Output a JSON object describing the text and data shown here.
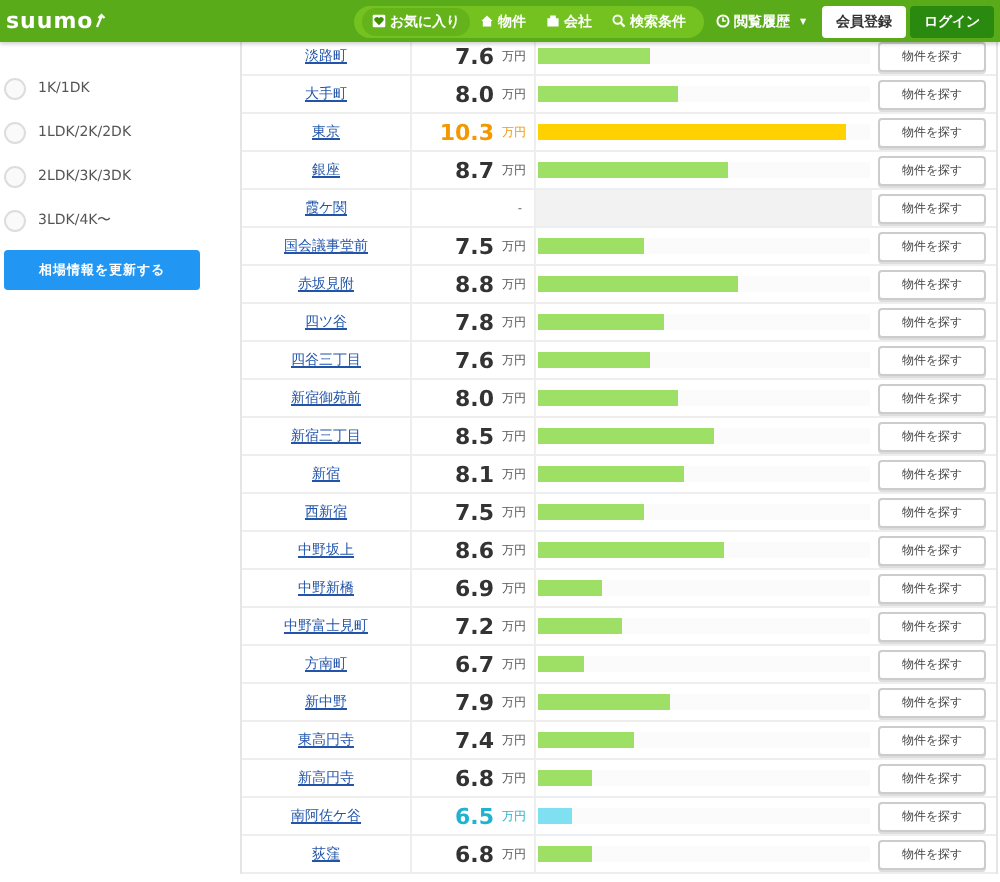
{
  "header": {
    "logo": "suumo",
    "nav": [
      {
        "label": "お気に入り",
        "selected": true
      },
      {
        "label": "物件",
        "selected": false
      },
      {
        "label": "会社",
        "selected": false
      },
      {
        "label": "検索条件",
        "selected": false
      }
    ],
    "history": {
      "label": "閲覧履歴",
      "caret": "▼"
    },
    "register": "会員登録",
    "login": "ログイン"
  },
  "sidebar": {
    "options": [
      {
        "label": "1K/1DK",
        "selected": false
      },
      {
        "label": "1LDK/2K/2DK",
        "selected": false
      },
      {
        "label": "2LDK/3K/3DK",
        "selected": false
      },
      {
        "label": "3LDK/4K〜",
        "selected": false
      }
    ],
    "update_button": "相場情報を更新する"
  },
  "table": {
    "rows": [
      {
        "station": "淡路町",
        "price": "7.6",
        "unit": "万円",
        "level": 0.34,
        "kind": "normal",
        "button": "物件を探す"
      },
      {
        "station": "大手町",
        "price": "8.0",
        "unit": "万円",
        "level": 0.42,
        "kind": "normal",
        "button": "物件を探す"
      },
      {
        "station": "東京",
        "price": "10.3",
        "unit": "万円",
        "level": 0.93,
        "kind": "highest",
        "button": "物件を探す"
      },
      {
        "station": "銀座",
        "price": "8.7",
        "unit": "万円",
        "level": 0.57,
        "kind": "normal",
        "button": "物件を探す"
      },
      {
        "station": "霞ケ関",
        "price": "-",
        "kind": "no_data",
        "button": "物件を探す"
      },
      {
        "station": "国会議事堂前",
        "price": "7.5",
        "unit": "万円",
        "level": 0.32,
        "kind": "normal",
        "button": "物件を探す"
      },
      {
        "station": "赤坂見附",
        "price": "8.8",
        "unit": "万円",
        "level": 0.6,
        "kind": "normal",
        "button": "物件を探す"
      },
      {
        "station": "四ツ谷",
        "price": "7.8",
        "unit": "万円",
        "level": 0.38,
        "kind": "normal",
        "button": "物件を探す"
      },
      {
        "station": "四谷三丁目",
        "price": "7.6",
        "unit": "万円",
        "level": 0.34,
        "kind": "normal",
        "button": "物件を探す"
      },
      {
        "station": "新宿御苑前",
        "price": "8.0",
        "unit": "万円",
        "level": 0.42,
        "kind": "normal",
        "button": "物件を探す"
      },
      {
        "station": "新宿三丁目",
        "price": "8.5",
        "unit": "万円",
        "level": 0.53,
        "kind": "normal",
        "button": "物件を探す"
      },
      {
        "station": "新宿",
        "price": "8.1",
        "unit": "万円",
        "level": 0.44,
        "kind": "normal",
        "button": "物件を探す"
      },
      {
        "station": "西新宿",
        "price": "7.5",
        "unit": "万円",
        "level": 0.32,
        "kind": "normal",
        "button": "物件を探す"
      },
      {
        "station": "中野坂上",
        "price": "8.6",
        "unit": "万円",
        "level": 0.56,
        "kind": "normal",
        "button": "物件を探す"
      },
      {
        "station": "中野新橋",
        "price": "6.9",
        "unit": "万円",
        "level": 0.19,
        "kind": "normal",
        "button": "物件を探す"
      },
      {
        "station": "中野富士見町",
        "price": "7.2",
        "unit": "万円",
        "level": 0.25,
        "kind": "normal",
        "button": "物件を探す"
      },
      {
        "station": "方南町",
        "price": "6.7",
        "unit": "万円",
        "level": 0.14,
        "kind": "normal",
        "button": "物件を探す"
      },
      {
        "station": "新中野",
        "price": "7.9",
        "unit": "万円",
        "level": 0.4,
        "kind": "normal",
        "button": "物件を探す"
      },
      {
        "station": "東高円寺",
        "price": "7.4",
        "unit": "万円",
        "level": 0.29,
        "kind": "normal",
        "button": "物件を探す"
      },
      {
        "station": "新高円寺",
        "price": "6.8",
        "unit": "万円",
        "level": 0.16,
        "kind": "normal",
        "button": "物件を探す"
      },
      {
        "station": "南阿佐ケ谷",
        "price": "6.5",
        "unit": "万円",
        "level": 0.1,
        "kind": "lowest",
        "button": "物件を探す"
      },
      {
        "station": "荻窪",
        "price": "6.8",
        "unit": "万円",
        "level": 0.16,
        "kind": "normal",
        "button": "物件を探す"
      }
    ]
  }
}
